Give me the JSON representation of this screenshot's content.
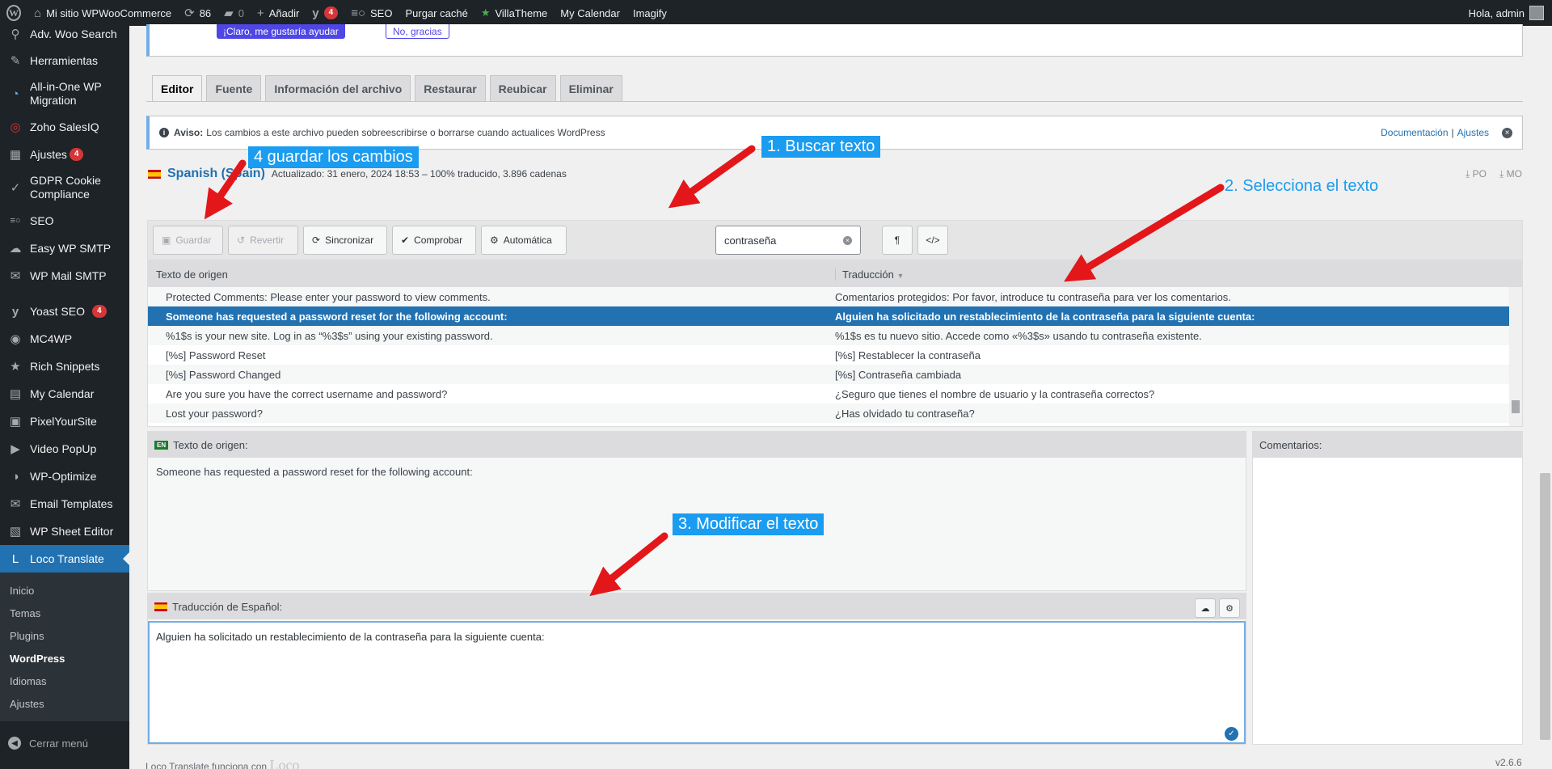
{
  "adminbar": {
    "site_name": "Mi sitio WPWooCommerce",
    "updates_count": "86",
    "comments_count": "0",
    "add_label": "Añadir",
    "yoast_badge": "4",
    "seo_label": "SEO",
    "purge_label": "Purgar caché",
    "villa_label": "VillaTheme",
    "calendar_label": "My Calendar",
    "imagify_label": "Imagify",
    "greeting": "Hola, admin"
  },
  "sidebar": {
    "items": [
      {
        "label": "Adv. Woo Search",
        "icon": "search-icon"
      },
      {
        "label": "Herramientas",
        "icon": "wrench-icon"
      },
      {
        "label": "All-in-One WP Migration",
        "icon": "migration-icon"
      },
      {
        "label": "Zoho SalesIQ",
        "icon": "zoho-icon"
      },
      {
        "label": "Ajustes",
        "icon": "settings-icon",
        "badge": "4"
      },
      {
        "label": "GDPR Cookie Compliance",
        "icon": "gdpr-icon"
      },
      {
        "label": "SEO",
        "icon": "seo-icon"
      },
      {
        "label": "Easy WP SMTP",
        "icon": "smtp-icon"
      },
      {
        "label": "WP Mail SMTP",
        "icon": "mail-smtp-icon"
      },
      {
        "label": "Yoast SEO",
        "icon": "yoast-icon",
        "badge": "4"
      },
      {
        "label": "MC4WP",
        "icon": "mc4wp-icon"
      },
      {
        "label": "Rich Snippets",
        "icon": "star-icon"
      },
      {
        "label": "My Calendar",
        "icon": "calendar-icon"
      },
      {
        "label": "PixelYourSite",
        "icon": "pixel-icon"
      },
      {
        "label": "Video PopUp",
        "icon": "video-icon"
      },
      {
        "label": "WP-Optimize",
        "icon": "optimize-icon"
      },
      {
        "label": "Email Templates",
        "icon": "email-icon"
      },
      {
        "label": "WP Sheet Editor",
        "icon": "sheet-icon"
      },
      {
        "label": "Loco Translate",
        "icon": "loco-icon"
      }
    ],
    "submenu": [
      "Inicio",
      "Temas",
      "Plugins",
      "WordPress",
      "Idiomas",
      "Ajustes"
    ],
    "collapse_label": "Cerrar menú"
  },
  "notice": {
    "yes_label": "¡Claro, me gustaría ayudar",
    "no_label": "No, gracias"
  },
  "tabs": [
    "Editor",
    "Fuente",
    "Información del archivo",
    "Restaurar",
    "Reubicar",
    "Eliminar"
  ],
  "warning": {
    "bold": "Aviso:",
    "text": "Los cambios a este archivo pueden sobreescribirse o borrarse cuando actualices WordPress",
    "doc_link": "Documentación",
    "sep": "|",
    "settings_link": "Ajustes"
  },
  "po": {
    "language": "Spanish (Spain)",
    "meta": "Actualizado: 31 enero, 2024 18:53 – 100% traducido, 3.896 cadenas",
    "po_label": "PO",
    "mo_label": "MO"
  },
  "toolbar": {
    "save": "Guardar",
    "revert": "Revertir",
    "sync": "Sincronizar",
    "check": "Comprobar",
    "auto": "Automática",
    "search_value": "contraseña"
  },
  "grid": {
    "col_source": "Texto de origen",
    "col_translation": "Traducción",
    "rows": [
      {
        "src": "Protected Comments: Please enter your password to view comments.",
        "tr": "Comentarios protegidos: Por favor, introduce tu contraseña para ver los comentarios."
      },
      {
        "src": "Someone has requested a password reset for the following account:",
        "tr": "Alguien ha solicitado un restablecimiento de la contraseña para la siguiente cuenta:"
      },
      {
        "src": "%1$s is your new site. Log in as “%3$s” using your existing password.",
        "tr": "%1$s es tu nuevo sitio. Accede como «%3$s» usando tu contraseña existente."
      },
      {
        "src": "[%s] Password Reset",
        "tr": "[%s] Restablecer la contraseña"
      },
      {
        "src": "[%s] Password Changed",
        "tr": "[%s] Contraseña cambiada"
      },
      {
        "src": "Are you sure you have the correct username and password?",
        "tr": "¿Seguro que tienes el nombre de usuario y la contraseña correctos?"
      },
      {
        "src": "Lost your password?",
        "tr": "¿Has olvidado tu contraseña?"
      }
    ]
  },
  "source_panel": {
    "flag": "EN",
    "title": "Texto de origen:",
    "text": "Someone has requested a password reset for the following account:"
  },
  "translation_panel": {
    "title": "Traducción de Español:",
    "value": "Alguien ha solicitado un restablecimiento de la contraseña para la siguiente cuenta:"
  },
  "comments_panel": {
    "title": "Comentarios:"
  },
  "footer": {
    "text": "Loco Translate funciona con",
    "version": "v2.6.6"
  },
  "annotations": {
    "step1": "1. Buscar texto",
    "step2": "2. Selecciona el texto",
    "step3": "3. Modificar el texto",
    "step4": "4 guardar los cambios",
    "color": "#1a9cf0",
    "arrow_color": "#e3171a"
  }
}
